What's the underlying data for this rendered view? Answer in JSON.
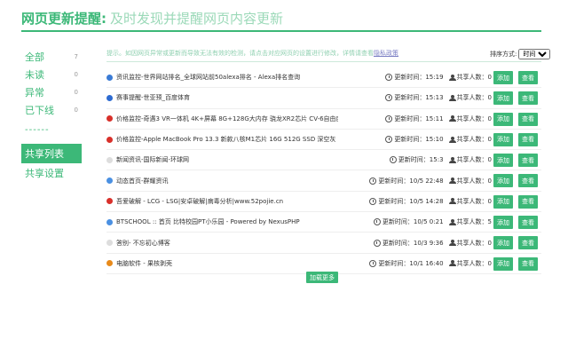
{
  "header": {
    "title": "网页更新提醒:",
    "subtitle": "及时发现并提醒网页内容更新"
  },
  "sidebar": {
    "items": [
      {
        "label": "全部",
        "count": "7"
      },
      {
        "label": "未读",
        "count": "0"
      },
      {
        "label": "异常",
        "count": "0"
      },
      {
        "label": "已下线",
        "count": "0"
      }
    ],
    "divider": "------",
    "share_list": "共享列表",
    "share_settings": "共享设置"
  },
  "notice": {
    "text": "提示。如因网页异常或更新而导致无法有效的检测，请点击对应网页的设置进行修改，详情请查看",
    "link": "隐私政策"
  },
  "sort": {
    "label": "排序方式:",
    "selected": "时间"
  },
  "rows": [
    {
      "name": "资讯监控-世界网站排名_全球网站前50alexa排名 - Alexa排名查询",
      "time_label": "更新时间：",
      "time": "15:19",
      "share_label": "共享人数：",
      "count": "0",
      "add": "添加",
      "view": "查看",
      "icon_color": "#3a7bd5"
    },
    {
      "name": "赛事提醒-世亚预_百度体育",
      "time_label": "更新时间：",
      "time": "15:13",
      "share_label": "共享人数：",
      "count": "0",
      "add": "添加",
      "view": "查看",
      "icon_color": "#2d6bd1"
    },
    {
      "name": "价格监控-奇遇3 VR一体机 4K+屏幕 8G+128G大内存 骁龙XR2芯片 CV-6自由度手柄 【小兔·王昧...",
      "time_label": "更新时间：",
      "time": "15:11",
      "share_label": "共享人数：",
      "count": "0",
      "add": "添加",
      "view": "查看",
      "icon_color": "#d8302a"
    },
    {
      "name": "价格监控-Apple MacBook Pro 13.3 新款八核M1芯片 16G 512G SSD 深空灰 笔记本电脑 轻薄本...",
      "time_label": "更新时间：",
      "time": "15:10",
      "share_label": "共享人数：",
      "count": "0",
      "add": "添加",
      "view": "查看",
      "icon_color": "#d8302a"
    },
    {
      "name": "新闻资讯-国际新闻-环球网",
      "time_label": "更新时间：",
      "time": "15:3",
      "share_label": "共享人数：",
      "count": "0",
      "add": "添加",
      "view": "查看",
      "icon_color": "#dddddd"
    },
    {
      "name": "动态首页-群耀资讯",
      "time_label": "更新时间：",
      "time": "10/5 22:48",
      "share_label": "共享人数：",
      "count": "0",
      "add": "添加",
      "view": "查看",
      "icon_color": "#4a90e2"
    },
    {
      "name": "吾爱破解 - LCG - LSG|安卓破解|病毒分析|www.52pojie.cn",
      "time_label": "更新时间：",
      "time": "10/5 14:28",
      "share_label": "共享人数：",
      "count": "0",
      "add": "添加",
      "view": "查看",
      "icon_color": "#d8302a"
    },
    {
      "name": "BTSCHOOL :: 首页 比特校园PT小乐园 - Powered by NexusPHP",
      "time_label": "更新时间：",
      "time": "10/5 0:21",
      "share_label": "共享人数：",
      "count": "5",
      "add": "添加",
      "view": "查看",
      "icon_color": "#4a90e2"
    },
    {
      "name": "答别- 不忘初心博客",
      "time_label": "更新时间：",
      "time": "10/3 9:36",
      "share_label": "共享人数：",
      "count": "0",
      "add": "添加",
      "view": "查看",
      "icon_color": "#dddddd"
    },
    {
      "name": "电脑软件 - 果核剥壳",
      "time_label": "更新时间：",
      "time": "10/1 16:40",
      "share_label": "共享人数：",
      "count": "0",
      "add": "添加",
      "view": "查看",
      "icon_color": "#e88a1a"
    }
  ],
  "load_more": "加载更多"
}
